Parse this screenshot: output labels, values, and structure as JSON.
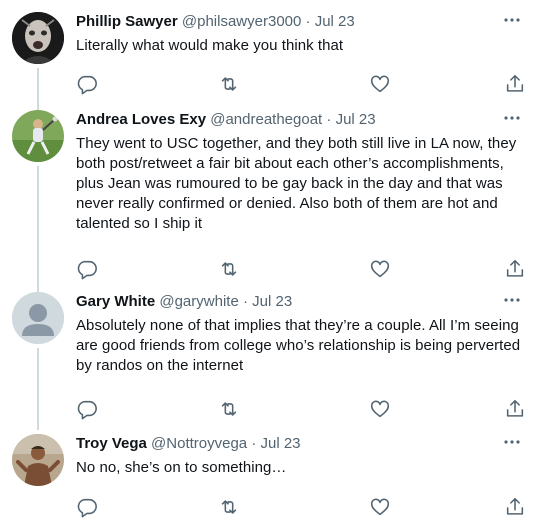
{
  "tweets": [
    {
      "name": "Phillip Sawyer",
      "handle": "@philsawyer3000",
      "separator": "·",
      "date": "Jul 23",
      "text": "Literally what would make you think that",
      "avatar": "photo-face-dark"
    },
    {
      "name": "Andrea Loves Exy",
      "handle": "@andreathegoat",
      "separator": "·",
      "date": "Jul 23",
      "text": "They went to USC together, and they both still live in LA now, they both post/retweet a fair bit about each other’s accomplishments, plus Jean was rumoured to be gay back in the day and that was never really confirmed or denied. Also both of them are hot and talented so I ship it",
      "avatar": "photo-lacrosse-player"
    },
    {
      "name": "Gary White",
      "handle": "@garywhite",
      "separator": "·",
      "date": "Jul 23",
      "text": "Absolutely none of that implies that they’re a couple. All I’m seeing are good friends from college who’s relationship is being perverted by randos on the internet",
      "avatar": "default-profile"
    },
    {
      "name": "Troy Vega",
      "handle": "@Nottroyvega",
      "separator": "·",
      "date": "Jul 23",
      "text": "No no, she’s on to something…",
      "avatar": "photo-person"
    }
  ],
  "icons": {
    "more": "more-horizontal-icon",
    "reply": "reply-icon",
    "retweet": "retweet-icon",
    "like": "heart-icon",
    "share": "share-icon"
  },
  "colors": {
    "text": "#0f1419",
    "secondary": "#536471",
    "thread_line": "#cfd9de"
  }
}
